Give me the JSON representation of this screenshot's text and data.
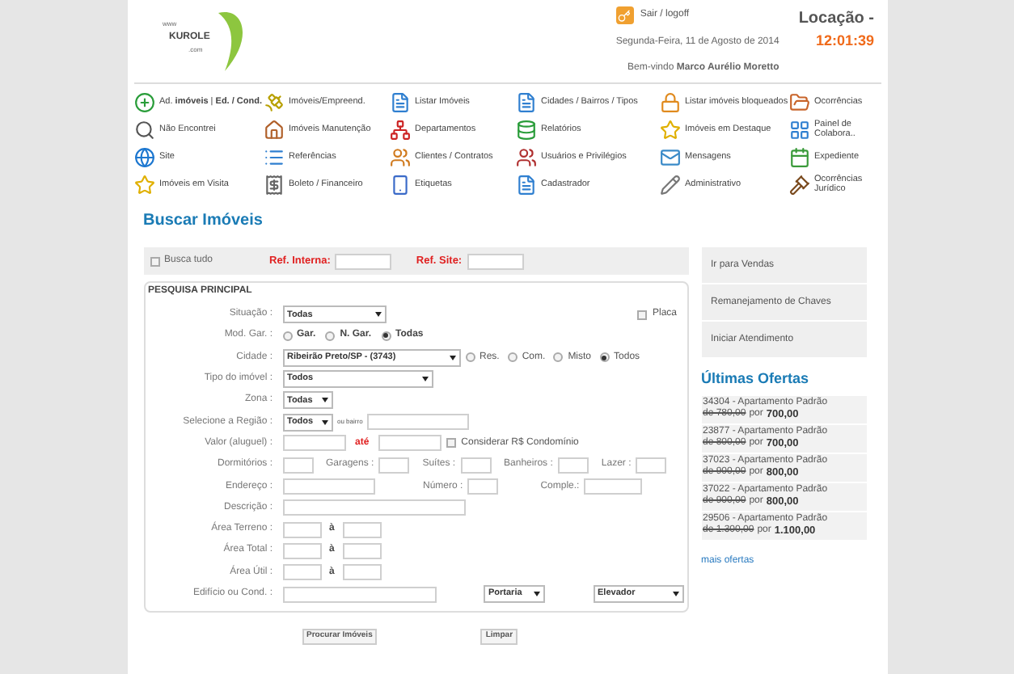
{
  "header": {
    "logo": {
      "prefix": "www",
      "name": "KUROLE",
      "suffix": ".com"
    },
    "logout": "Sair / logoff",
    "location": "Locação -",
    "clock": "12:01:39",
    "date": "Segunda-Feira, 11 de Agosto de 2014",
    "welcome": "Bem-vindo **Marco Aurélio Moretto**"
  },
  "menu": [
    {
      "label": "Ad. **imóveis** | **Ed. / Cond.**"
    },
    {
      "label": "Imóveis/Empreend."
    },
    {
      "label": "Listar Imóveis"
    },
    {
      "label": "Cidades / Bairros / Tipos"
    },
    {
      "label": "Listar imóveis bloqueados"
    },
    {
      "label": "Ocorrências"
    },
    {
      "label": "Não Encontrei"
    },
    {
      "label": "Imóveis Manutenção"
    },
    {
      "label": "Departamentos"
    },
    {
      "label": "Relatórios"
    },
    {
      "label": "Imóveis em Destaque"
    },
    {
      "label": "Painel de Colabora.."
    },
    {
      "label": "Site"
    },
    {
      "label": "Referências"
    },
    {
      "label": "Clientes / Contratos"
    },
    {
      "label": "Usuários e Privilégios"
    },
    {
      "label": "Mensagens"
    },
    {
      "label": "Expediente"
    },
    {
      "label": "Imóveis em Visita"
    },
    {
      "label": "Boleto / Financeiro"
    },
    {
      "label": "Etiquetas"
    },
    {
      "label": "Cadastrador"
    },
    {
      "label": "Administrativo"
    },
    {
      "label": "Ocorrências Jurídico"
    }
  ],
  "page_title": "Buscar Imóveis",
  "form": {
    "busca_tudo": {
      "label": "Busca tudo",
      "checked": false
    },
    "ref_interna": {
      "label": "Ref. Interna:"
    },
    "ref_site": {
      "label": "Ref. Site:"
    },
    "section_title": "PESQUISA PRINCIPAL",
    "situacao": {
      "label": "Situação :",
      "value": "Todas"
    },
    "placa": {
      "label": "Placa",
      "checked": false
    },
    "mod_gar": {
      "label": "Mod. Gar. :",
      "options": [
        {
          "label": "Gar.",
          "selected": false
        },
        {
          "label": "N. Gar.",
          "selected": false
        },
        {
          "label": "Todas",
          "selected": true
        }
      ]
    },
    "cidade": {
      "label": "Cidade :",
      "value": "Ribeirão Preto/SP - (3743)",
      "options": [
        {
          "label": "Res.",
          "selected": false
        },
        {
          "label": "Com.",
          "selected": false
        },
        {
          "label": "Misto",
          "selected": false
        },
        {
          "label": "Todos",
          "selected": true
        }
      ]
    },
    "tipo": {
      "label": "Tipo do imóvel :",
      "value": "Todos"
    },
    "zona": {
      "label": "Zona :",
      "value": "Todas"
    },
    "regiao": {
      "label": "Selecione a Região :",
      "value": "Todos",
      "hint": "ou bairro"
    },
    "valor": {
      "label": "Valor (aluguel) :",
      "connector": "até",
      "condominio": {
        "label": "Considerar R$ Condomínio",
        "checked": false
      }
    },
    "counts": [
      {
        "label": "Dormitórios :"
      },
      {
        "label": "Garagens :"
      },
      {
        "label": "Suítes :"
      },
      {
        "label": "Banheiros :"
      },
      {
        "label": "Lazer :"
      }
    ],
    "address": [
      {
        "label": "Endereço :"
      },
      {
        "label": "Número :"
      },
      {
        "label": "Comple.:"
      }
    ],
    "descricao": {
      "label": "Descrição :"
    },
    "areas": [
      {
        "label": "Área Terreno :",
        "connector": "à"
      },
      {
        "label": "Área Total :",
        "connector": "à"
      },
      {
        "label": "Área Útil :",
        "connector": "à"
      }
    ],
    "edificio": {
      "label": "Edifício ou Cond. :"
    },
    "portaria": {
      "value": "Portaria"
    },
    "elevador": {
      "value": "Elevador"
    }
  },
  "buttons": [
    "Procurar Imóveis",
    "Limpar"
  ],
  "side_actions": [
    "Ir para Vendas",
    "Remanejamento de Chaves",
    "Iniciar Atendimento"
  ],
  "offers_title": "Últimas Ofertas",
  "offers": [
    {
      "title": "34304 - Apartamento Padrão",
      "old_price": "de 780,00",
      "connector": "por",
      "price": "700,00"
    },
    {
      "title": "23877 - Apartamento Padrão",
      "old_price": "de 800,00",
      "connector": "por",
      "price": "700,00"
    },
    {
      "title": "37023 - Apartamento Padrão",
      "old_price": "de 900,00",
      "connector": "por",
      "price": "800,00"
    },
    {
      "title": "37022 - Apartamento Padrão",
      "old_price": "de 900,00",
      "connector": "por",
      "price": "800,00"
    },
    {
      "title": "29506 - Apartamento Padrão",
      "old_price": "de 1.300,00",
      "connector": "por",
      "price": "1.100,00"
    }
  ],
  "more_offers": "mais ofertas"
}
